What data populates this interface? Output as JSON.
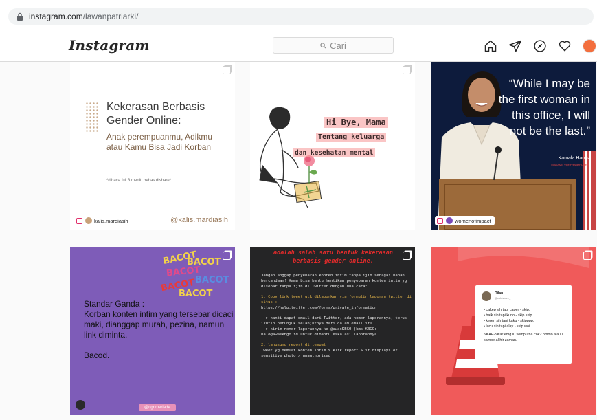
{
  "browser": {
    "url_domain": "instagram.com",
    "url_path": "/lawanpatriarki/"
  },
  "header": {
    "logo": "Instagram",
    "search_placeholder": "Cari"
  },
  "posts": [
    {
      "title": "Kekerasan Berbasis Gender Online:",
      "subtitle": "Anak perempuanmu, Adikmu atau Kamu Bisa Jadi Korban",
      "note": "*dibaca full 3 menit, bebas dishare*",
      "watermark": "@kalis.mardiasih",
      "tagged_user": "kalis.mardiasih"
    },
    {
      "line1": "Hi Bye, Mama",
      "line2": "Tentang keluarga",
      "line3": "dan kesehatan mental"
    },
    {
      "quote": "“While I may be the first woman in this office, I will not be the last.”",
      "author": "Kamala Harris",
      "author_role": "MADAME Vice President-Elect",
      "tagged_user": "womenofimpact"
    },
    {
      "stickers": [
        "BACOT",
        "BACOT",
        "BACOT",
        "BACOT",
        "BACOT",
        "BACOT"
      ],
      "line1": "Standar Ganda :",
      "line2": "Korban konten intim yang tersebar dicaci maki, dianggap murah, pezina, namun link diminta.",
      "line3": "Bacod.",
      "handle": "@ngrimeriade"
    },
    {
      "headline": "adalah salah satu bentuk kekerasan berbasis gender online.",
      "p1": "Jangan anggap penyebaran konten intim tanpa ijin sebagai bahan bercandaan! Kamu bisa bantu hentikan penyebaran konten intim yg disebar tanpa ijin di Twitter dengan dua cara:",
      "s1": "1. Copy link tweet utk dilaporkan via formulir laporan twitter di situs :",
      "s1_url": "https://help.twitter.com/forms/private_information",
      "s1a": "--> nanti dapat email dari Twitter, ada nomor laporannya, terus ikutin petunjuk selanjutnya dari dalam email itu",
      "s1b": "--> kirim nomor laporannya ke @awasKBGO (kms KBGO: halo@awaskbgo.id untuk dibantu eskalasi laporannya.",
      "s2": "2. langsung report di tempat",
      "s2a": "Tweet yg memuat konten intim > klik report > it displays of sensitive photo > unauthorized"
    },
    {
      "author": "Dilan",
      "handle": "@coldsteve_",
      "items": [
        "• cakep sih tapi caper - skip.",
        "• baik sih tapi kuno - skip skip.",
        "• keren sih tapi kaku - skipppp.",
        "• lucu sih tapi alay - skip woi."
      ],
      "footer": "SKAP-SKIP emg lu sempurna cok? omblo aja lu sampe akhir zaman."
    }
  ]
}
